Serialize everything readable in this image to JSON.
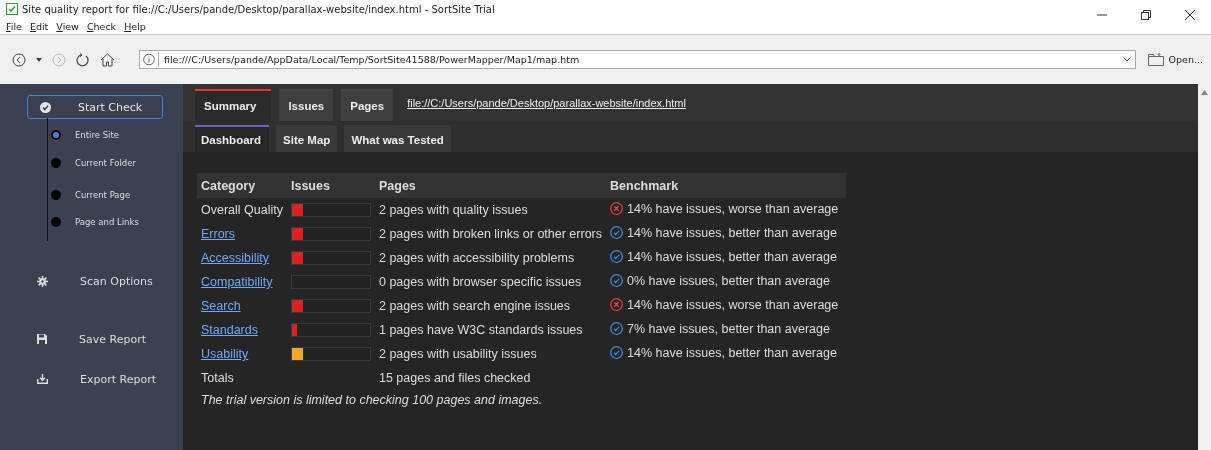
{
  "window": {
    "title": "Site quality report for file://C:/Users/pande/Desktop/parallax-website/index.html - SortSite Trial"
  },
  "menu": [
    "File",
    "Edit",
    "View",
    "Check",
    "Help"
  ],
  "address_bar": {
    "value": "file:///C:/Users/pande/AppData/Local/Temp/SortSite41588/PowerMapper/Map1/map.htm"
  },
  "open_button": "Open...",
  "sidebar": {
    "start_check": {
      "label": "Start Check",
      "selected": true
    },
    "scope_options": [
      {
        "label": "Entire Site",
        "selected": true
      },
      {
        "label": "Current Folder",
        "selected": false
      },
      {
        "label": "Current Page",
        "selected": false
      },
      {
        "label": "Page and Links",
        "selected": false
      }
    ],
    "actions": [
      {
        "kind": "gear",
        "label": "Scan Options"
      },
      {
        "kind": "save",
        "label": "Save Report"
      },
      {
        "kind": "export",
        "label": "Export Report"
      }
    ]
  },
  "tabs": [
    {
      "label": "Summary",
      "selected": true
    },
    {
      "label": "Issues",
      "selected": false
    },
    {
      "label": "Pages",
      "selected": false
    }
  ],
  "report_link": "file://C:/Users/pande/Desktop/parallax-website/index.html",
  "subtabs": [
    {
      "label": "Dashboard",
      "selected": true
    },
    {
      "label": "Site Map",
      "selected": false
    },
    {
      "label": "What was Tested",
      "selected": false
    }
  ],
  "table": {
    "columns": [
      "Category",
      "Issues",
      "Pages",
      "Benchmark"
    ],
    "rows": [
      {
        "category": "Overall Quality",
        "link": false,
        "level": 0.14,
        "color": "#e02020",
        "pages": "2 pages with quality issues",
        "kind": "worse",
        "benchmark": "14% have issues, worse than average"
      },
      {
        "category": "Errors",
        "link": true,
        "level": 0.14,
        "color": "#e02020",
        "pages": "2 pages with broken links or other errors",
        "kind": "better",
        "benchmark": "14% have issues, better than average"
      },
      {
        "category": "Accessibility",
        "link": true,
        "level": 0.14,
        "color": "#e02020",
        "pages": "2 pages with accessibility problems",
        "kind": "better",
        "benchmark": "14% have issues, better than average"
      },
      {
        "category": "Compatibility",
        "link": true,
        "pages": "0 pages with browser specific issues",
        "kind": "better",
        "benchmark": "0% have issues, better than average"
      },
      {
        "category": "Search",
        "link": true,
        "level": 0.14,
        "color": "#e02020",
        "pages": "2 pages with search engine issues",
        "kind": "worse",
        "benchmark": "14% have issues, worse than average"
      },
      {
        "category": "Standards",
        "link": true,
        "level": 0.07,
        "color": "#e02020",
        "pages": "1 pages have W3C standards issues",
        "kind": "better",
        "benchmark": "7% have issues, better than average"
      },
      {
        "category": "Usability",
        "link": true,
        "level": 0.14,
        "color": "#f5a623",
        "pages": "2 pages with usability issues",
        "kind": "better",
        "benchmark": "14% have issues, better than average"
      }
    ],
    "totals": {
      "label": "Totals",
      "pages": "15 pages and files checked"
    }
  },
  "note": "The trial version is limited to checking 100 pages and images."
}
